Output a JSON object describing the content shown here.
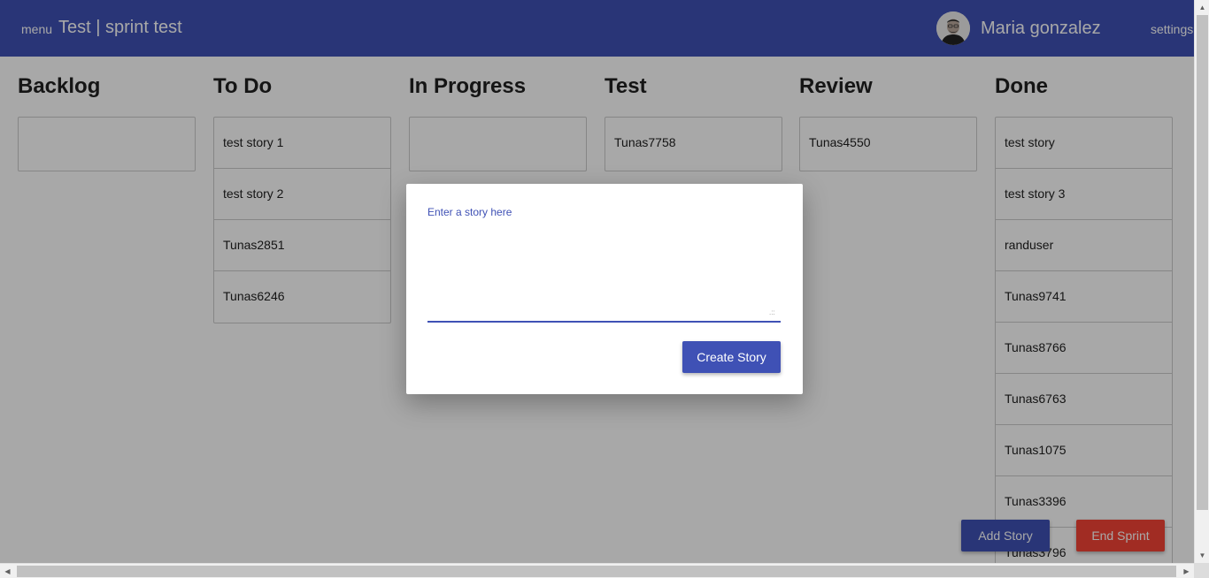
{
  "header": {
    "menu_label": "menu",
    "title": "Test | sprint test",
    "user_name": "Maria gonzalez",
    "settings_label": "settings"
  },
  "board": {
    "columns": [
      {
        "title": "Backlog",
        "stories": []
      },
      {
        "title": "To Do",
        "stories": [
          "test story 1",
          "test story 2",
          "Tunas2851",
          "Tunas6246"
        ]
      },
      {
        "title": "In Progress",
        "stories": []
      },
      {
        "title": "Test",
        "stories": [
          "Tunas7758"
        ]
      },
      {
        "title": "Review",
        "stories": [
          "Tunas4550"
        ]
      },
      {
        "title": "Done",
        "stories": [
          "test story",
          "test story 3",
          "randuser",
          "Tunas9741",
          "Tunas8766",
          "Tunas6763",
          "Tunas1075",
          "Tunas3396",
          "Tunas3796"
        ]
      }
    ]
  },
  "actions": {
    "add_story_label": "Add Story",
    "end_sprint_label": "End Sprint"
  },
  "dialog": {
    "story_label": "Enter a story here",
    "story_value": "",
    "create_label": "Create Story"
  },
  "colors": {
    "primary": "#3f51b5",
    "danger": "#f44336"
  }
}
